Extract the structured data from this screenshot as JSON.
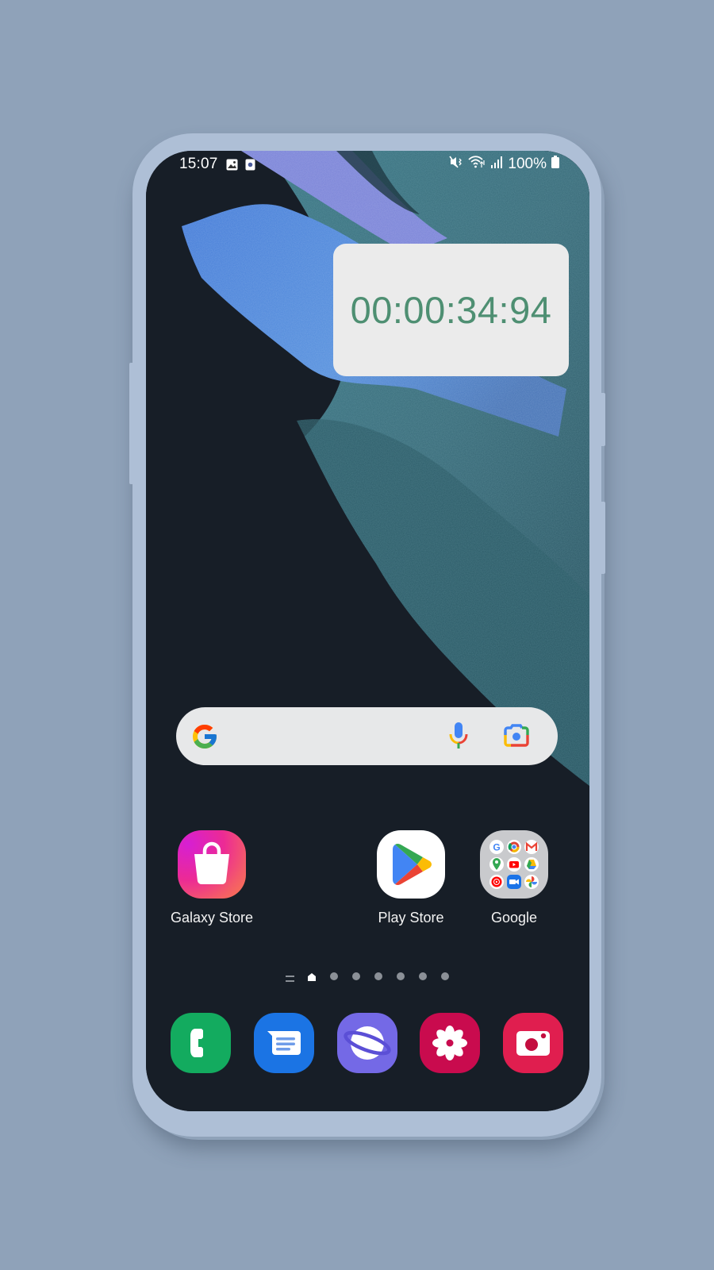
{
  "status_bar": {
    "time": "15:07",
    "left_icons": [
      "gallery-notification-icon",
      "screen-recorder-notification-icon"
    ],
    "right_icons": [
      "vibrate-mute-icon",
      "wifi-icon",
      "signal-icon"
    ],
    "battery": "100%"
  },
  "widget": {
    "type": "stopwatch",
    "time": "00:00:34:94",
    "text_color": "#4e8f72"
  },
  "search_bar": {
    "logo": "google-g-icon",
    "voice": "mic-icon",
    "lens": "google-lens-icon"
  },
  "home_apps": [
    {
      "label": "Galaxy Store",
      "icon": "shopping-bag-icon"
    },
    {
      "label": "Play Store",
      "icon": "play-store-icon"
    },
    {
      "label": "Google",
      "icon": "folder-icon",
      "folder_apps": [
        "Google",
        "Chrome",
        "Gmail",
        "Maps",
        "YouTube",
        "Drive",
        "YouTube Music",
        "Meet",
        "Photos"
      ]
    }
  ],
  "page_indicator": {
    "pages": 7,
    "current": 1
  },
  "dock": [
    {
      "name": "Phone",
      "color": "#13ab5f"
    },
    {
      "name": "Messages",
      "color": "#1b74e4"
    },
    {
      "name": "Samsung Internet",
      "color": "#7469e6"
    },
    {
      "name": "Bixby Vision / Blossom",
      "color": "#c90b4e"
    },
    {
      "name": "Camera",
      "color": "#e01e4f"
    }
  ]
}
